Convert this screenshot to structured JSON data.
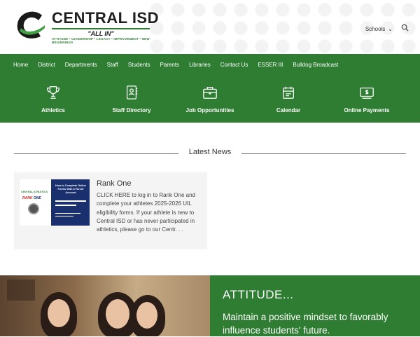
{
  "header": {
    "title": "CENTRAL ISD",
    "motto": "\"ALL IN\"",
    "tagline": "ATTITUDE • LEADERSHIP • LEGACY • IMPROVEMENT • NEW BEGINNINGS",
    "schools_label": "Schools"
  },
  "nav": {
    "items": [
      "Home",
      "District",
      "Departments",
      "Staff",
      "Students",
      "Parents",
      "Libraries",
      "Contact Us",
      "ESSER III",
      "Bulldog Broadcast"
    ]
  },
  "quick_links": [
    {
      "label": "Athletics",
      "icon": "trophy-icon"
    },
    {
      "label": "Staff Directory",
      "icon": "directory-icon"
    },
    {
      "label": "Job Opportunities",
      "icon": "briefcase-icon"
    },
    {
      "label": "Calendar",
      "icon": "calendar-icon"
    },
    {
      "label": "Online Payments",
      "icon": "payment-icon"
    }
  ],
  "news": {
    "heading": "Latest News",
    "card": {
      "title": "Rank One",
      "body": "CLICK HERE to log in to Rank One and complete your athletes 2025-2026 UIL eligibility forms. If your athlete is new to Central ISD or has never participated in athletics, please go to our Centr. . .",
      "image_text": {
        "left_label": "CENTRAL ATHLETICS",
        "rank": "RANK",
        "one": "ONE",
        "heading": "How to Complete Online Forms With a Parent Account"
      }
    }
  },
  "hero": {
    "title": "ATTITUDE...",
    "description": "Maintain a positive mindset to favorably influence students' future."
  },
  "colors": {
    "brand_green": "#2e7d32",
    "navy": "#1a2f6e"
  }
}
